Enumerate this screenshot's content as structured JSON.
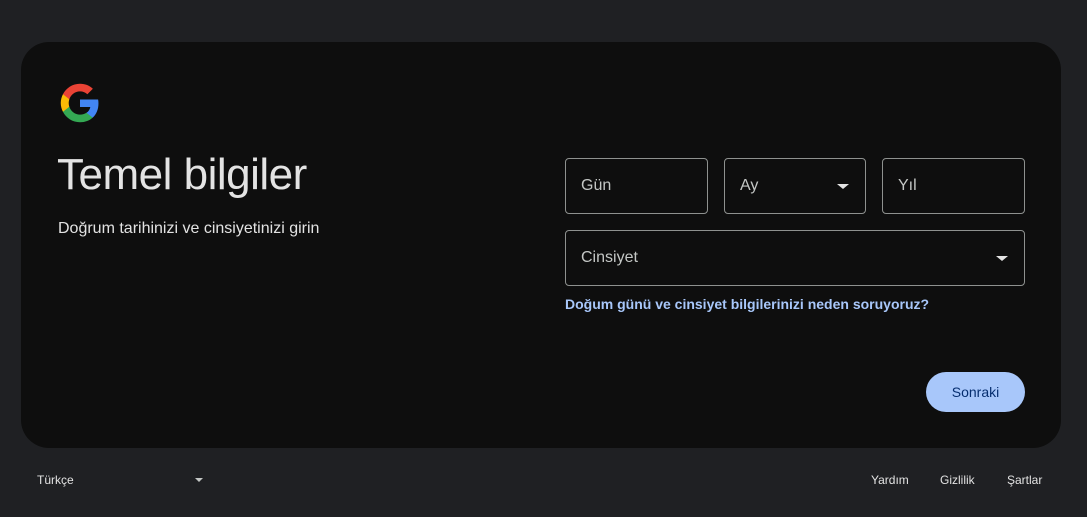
{
  "header": {
    "logo_icon": "google-g-logo-icon",
    "title": "Temel bilgiler",
    "subtitle": "Doğrum tarihinizi ve cinsiyetinizi girin"
  },
  "form": {
    "day_placeholder": "Gün",
    "month_placeholder": "Ay",
    "year_placeholder": "Yıl",
    "gender_placeholder": "Cinsiyet",
    "why_link": "Doğum günü ve cinsiyet bilgilerinizi neden soruyoruz?",
    "next_button": "Sonraki"
  },
  "footer": {
    "language": "Türkçe",
    "help": "Yardım",
    "privacy": "Gizlilik",
    "terms": "Şartlar"
  },
  "colors": {
    "page_background": "#1f2023",
    "card_background": "#0e0e0e",
    "accent": "#a8c7fa",
    "button_text": "#062e6f",
    "field_border": "#8e918f"
  }
}
